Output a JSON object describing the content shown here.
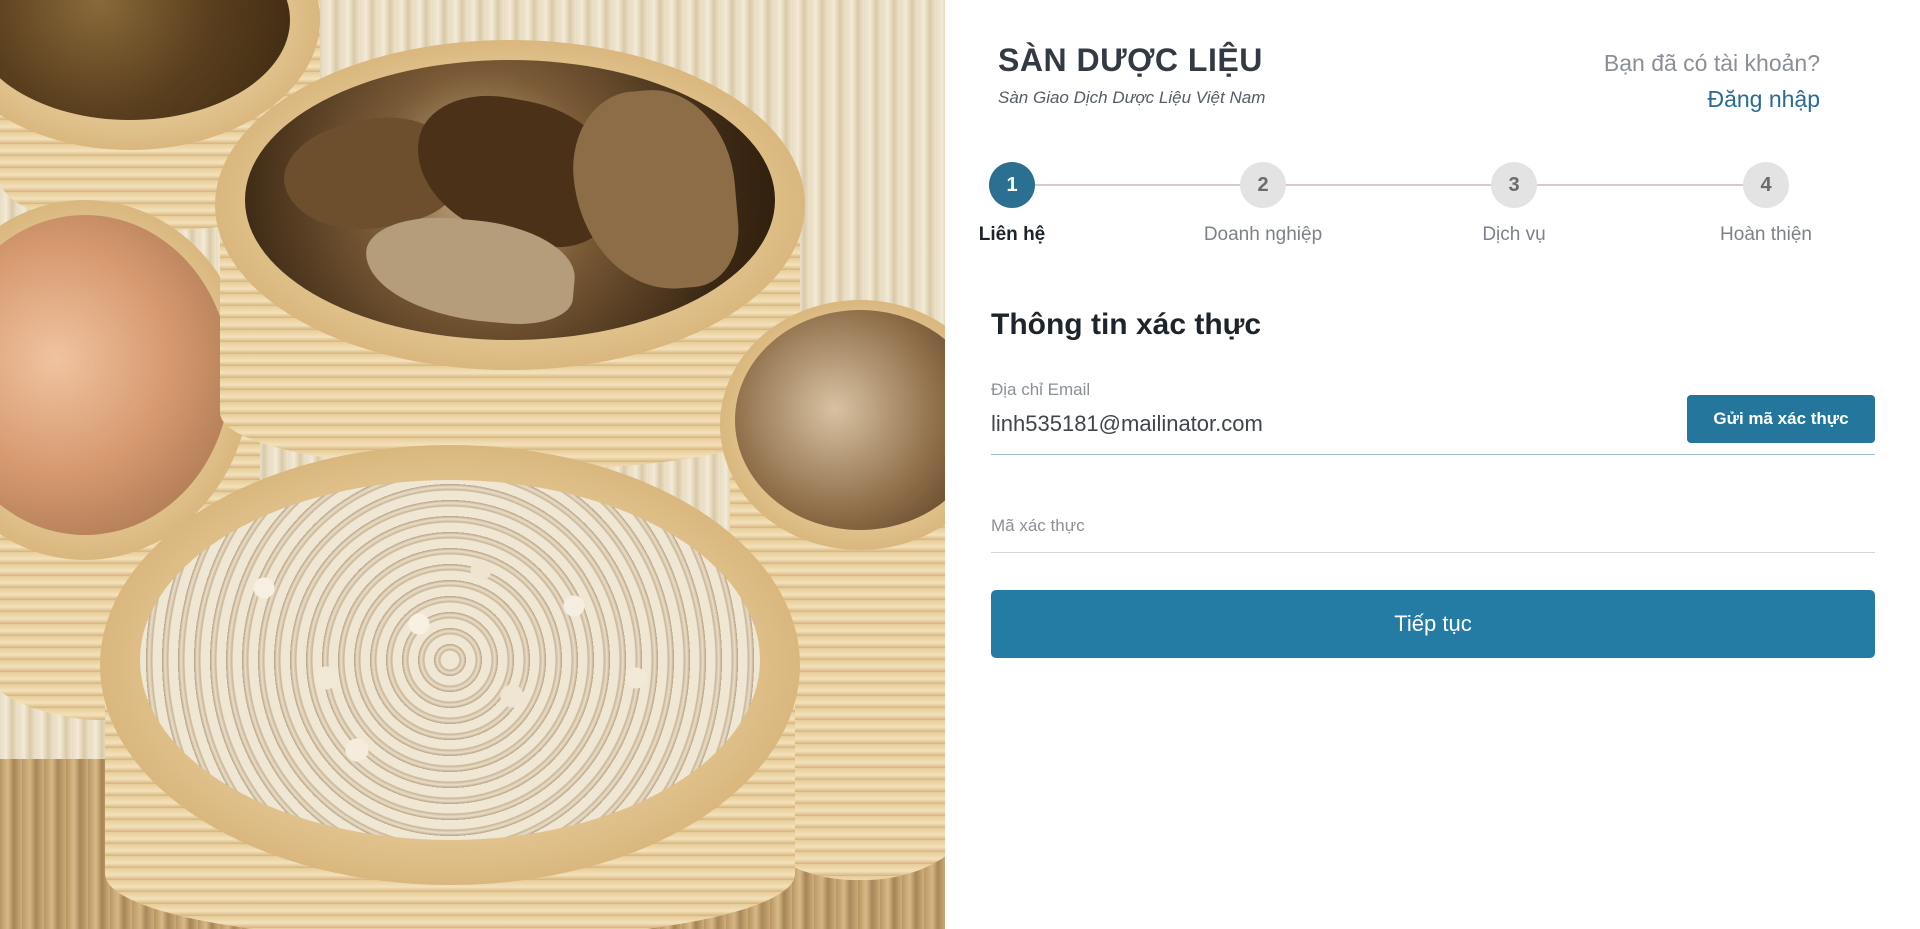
{
  "brand": {
    "title": "SÀN DƯỢC LIỆU",
    "subtitle": "Sàn Giao Dịch Dược Liệu Việt Nam"
  },
  "account": {
    "prompt": "Bạn đã có tài khoản?",
    "login_label": "Đăng nhập"
  },
  "stepper": {
    "active_step": 1,
    "steps": [
      {
        "number": "1",
        "label": "Liên hệ"
      },
      {
        "number": "2",
        "label": "Doanh nghiệp"
      },
      {
        "number": "3",
        "label": "Dịch vụ"
      },
      {
        "number": "4",
        "label": "Hoàn thiện"
      }
    ]
  },
  "form": {
    "section_title": "Thông tin xác thực",
    "email": {
      "label": "Địa chỉ Email",
      "value": "linh535181@mailinator.com"
    },
    "send_code_label": "Gửi mã xác thực",
    "code": {
      "label": "Mã xác thực",
      "value": ""
    },
    "continue_label": "Tiếp tục"
  },
  "colors": {
    "primary": "#24769d",
    "link": "#2a6a93",
    "step_active": "#2b6f91",
    "step_inactive": "#e3e3e3"
  }
}
